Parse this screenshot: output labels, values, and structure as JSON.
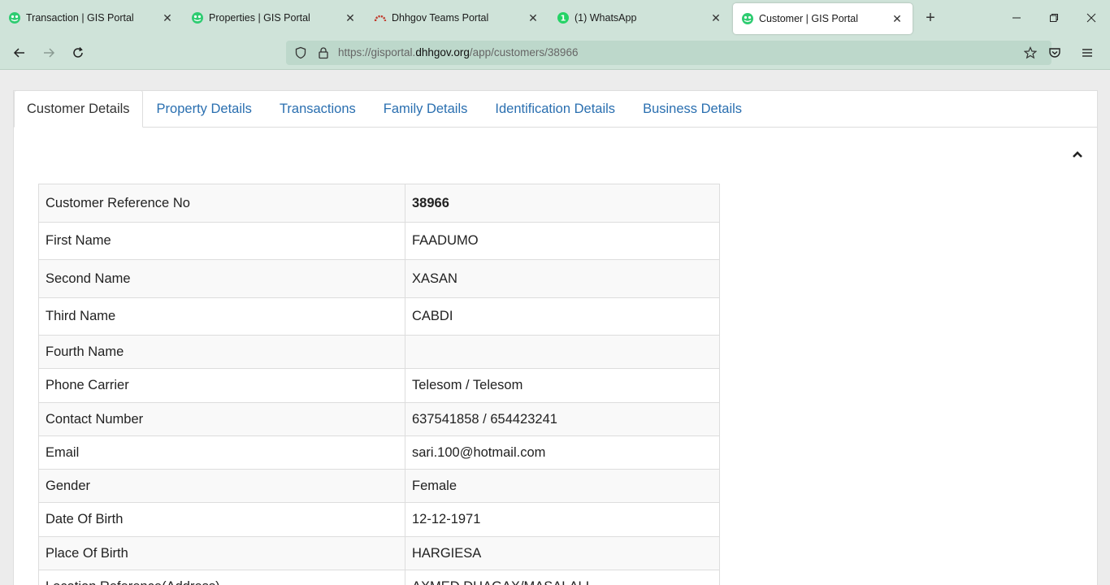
{
  "browser": {
    "tabs": [
      {
        "title": "Transaction | GIS Portal",
        "icon": "gis-portal-icon",
        "active": false
      },
      {
        "title": "Properties | GIS Portal",
        "icon": "gis-portal-icon",
        "active": false
      },
      {
        "title": "Dhhgov Teams Portal",
        "icon": "teams-portal-icon",
        "active": false
      },
      {
        "title": "(1) WhatsApp",
        "icon": "whatsapp-icon",
        "active": false
      },
      {
        "title": "Customer | GIS Portal",
        "icon": "gis-portal-icon",
        "active": true
      }
    ],
    "url": {
      "prefix": "https://gisportal.",
      "domain": "dhhgov.org",
      "path": "/app/customers/38966"
    }
  },
  "page": {
    "tabs": [
      {
        "label": "Customer Details",
        "active": true
      },
      {
        "label": "Property Details",
        "active": false
      },
      {
        "label": "Transactions",
        "active": false
      },
      {
        "label": "Family Details",
        "active": false
      },
      {
        "label": "Identification Details",
        "active": false
      },
      {
        "label": "Business Details",
        "active": false
      }
    ],
    "details": [
      {
        "label": "Customer Reference No",
        "value": "38966"
      },
      {
        "label": "First Name",
        "value": "FAADUMO"
      },
      {
        "label": "Second Name",
        "value": "XASAN"
      },
      {
        "label": "Third Name",
        "value": "CABDI"
      },
      {
        "label": "Fourth Name",
        "value": ""
      },
      {
        "label": "Phone Carrier",
        "value": "Telesom / Telesom"
      },
      {
        "label": "Contact Number",
        "value": "637541858 / 654423241"
      },
      {
        "label": "Email",
        "value": "sari.100@hotmail.com"
      },
      {
        "label": "Gender",
        "value": "Female"
      },
      {
        "label": "Date Of Birth",
        "value": "12-12-1971"
      },
      {
        "label": "Place Of Birth",
        "value": "HARGIESA"
      },
      {
        "label": "Location Reference(Address)",
        "value": "AXMED DHAGAX/MASALALI"
      }
    ]
  },
  "colors": {
    "chrome": "#cfe3d9",
    "link": "#2a6fb0",
    "whatsapp": "#25d366",
    "gis": "#2ecc71"
  }
}
